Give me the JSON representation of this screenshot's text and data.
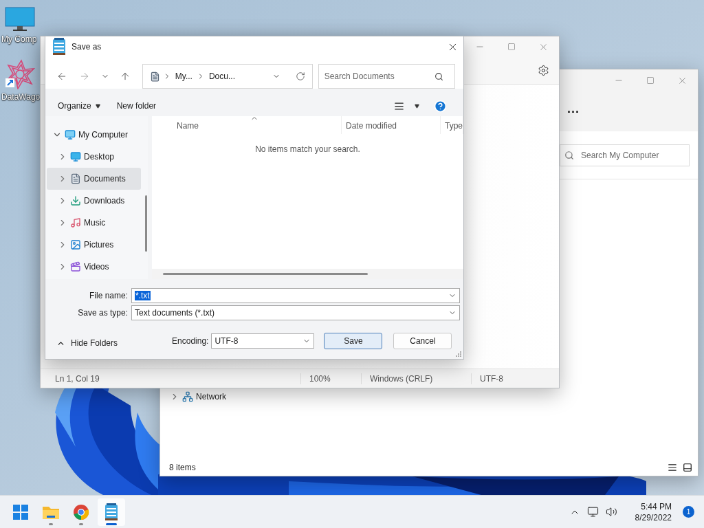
{
  "desktop": {
    "icons": [
      {
        "label": "My Comp",
        "kind": "computer"
      },
      {
        "label": "DataWago",
        "kind": "shortcut"
      }
    ]
  },
  "explorer": {
    "more": "...",
    "search": {
      "placeholder": "Search My Computer"
    },
    "tree": [
      {
        "label": "Network",
        "kind": "network",
        "expanded": false
      }
    ],
    "status": "8 items"
  },
  "notepad": {
    "status_bar": [
      "Ln 1, Col 19",
      "100%",
      "Windows (CRLF)",
      "UTF-8"
    ]
  },
  "dialog": {
    "title": "Save as",
    "breadcrumb": [
      "My...",
      "Docu..."
    ],
    "search": {
      "placeholder": "Search Documents"
    },
    "organize": "Organize",
    "new_folder": "New folder",
    "tree": [
      {
        "label": "My Computer",
        "kind": "computer",
        "expanded": true,
        "selected": false,
        "children": [
          {
            "label": "Desktop",
            "kind": "desktop",
            "expanded": false,
            "selected": false
          },
          {
            "label": "Documents",
            "kind": "documents",
            "expanded": false,
            "selected": true
          },
          {
            "label": "Downloads",
            "kind": "downloads",
            "expanded": false,
            "selected": false
          },
          {
            "label": "Music",
            "kind": "music",
            "expanded": false,
            "selected": false
          },
          {
            "label": "Pictures",
            "kind": "pictures",
            "expanded": false,
            "selected": false
          },
          {
            "label": "Videos",
            "kind": "videos",
            "expanded": false,
            "selected": false
          }
        ]
      }
    ],
    "columns": [
      "Name",
      "Date modified",
      "Type"
    ],
    "empty_message": "No items match your search.",
    "file_name": {
      "label": "File name:",
      "value": "*.txt"
    },
    "save_as_type": {
      "label": "Save as type:",
      "value": "Text documents (*.txt)"
    },
    "hide_folders": "Hide Folders",
    "encoding": {
      "label": "Encoding:",
      "value": "UTF-8"
    },
    "buttons": [
      {
        "label": "Save",
        "kind": "primary"
      },
      {
        "label": "Cancel",
        "kind": "secondary"
      }
    ]
  },
  "taskbar": {
    "apps": [
      {
        "kind": "start",
        "running": false,
        "selected": false
      },
      {
        "kind": "folder",
        "running": true,
        "selected": false
      },
      {
        "kind": "browser",
        "running": true,
        "selected": false
      },
      {
        "kind": "notepad",
        "running": true,
        "selected": true
      }
    ],
    "clock": {
      "time": "5:44 PM",
      "date": "8/29/2022"
    },
    "notifications": "1"
  }
}
